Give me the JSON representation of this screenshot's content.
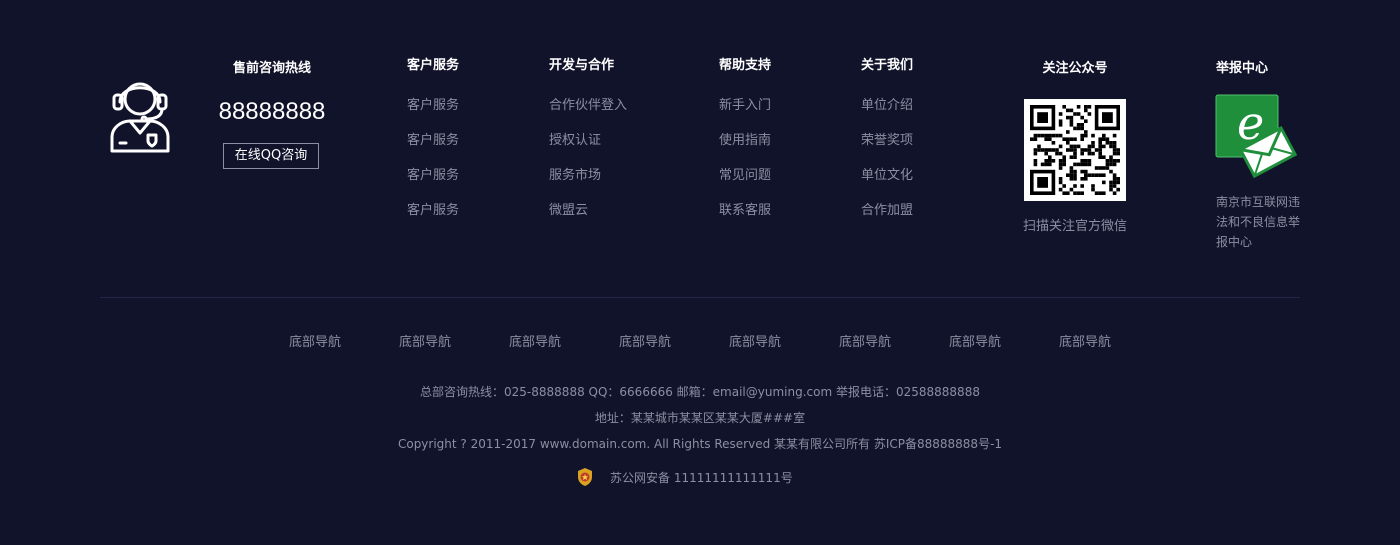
{
  "hotline": {
    "title": "售前咨询热线",
    "number": "88888888",
    "qq_button": "在线QQ咨询",
    "avatar_icon": "customer-service-headset-icon"
  },
  "columns": [
    {
      "title": "客户服务",
      "items": [
        "客户服务",
        "客户服务",
        "客户服务",
        "客户服务"
      ]
    },
    {
      "title": "开发与合作",
      "items": [
        "合作伙伴登入",
        "授权认证",
        "服务市场",
        "微盟云"
      ]
    },
    {
      "title": "帮助支持",
      "items": [
        "新手入门",
        "使用指南",
        "常见问题",
        "联系客服"
      ]
    },
    {
      "title": "关于我们",
      "items": [
        "单位介绍",
        "荣誉奖项",
        "单位文化",
        "合作加盟"
      ]
    }
  ],
  "wechat": {
    "title": "关注公众号",
    "caption": "扫描关注官方微信",
    "qr_icon": "wechat-qr-code"
  },
  "report": {
    "title": "举报中心",
    "caption": "南京市互联网违法和不良信息举报中心",
    "icon": "email-report-icon"
  },
  "bottom_nav": [
    "底部导航",
    "底部导航",
    "底部导航",
    "底部导航",
    "底部导航",
    "底部导航",
    "底部导航",
    "底部导航"
  ],
  "info": {
    "contact": "总部咨询热线：025-8888888 QQ：6666666 邮箱：email@yuming.com 举报电话：02588888888",
    "address": "地址：某某城市某某区某某大厦###室",
    "copyright": "Copyright ? 2011-2017 www.domain.com. All Rights Reserved 某某有限公司所有 苏ICP备88888888号-1",
    "police": "苏公网安备 11111111111111号",
    "police_icon": "police-badge-icon"
  },
  "colors": {
    "background": "#10132a",
    "link_text": "#8c8fa3",
    "heading_text": "#ffffff",
    "report_green": "#1f8f3c"
  }
}
